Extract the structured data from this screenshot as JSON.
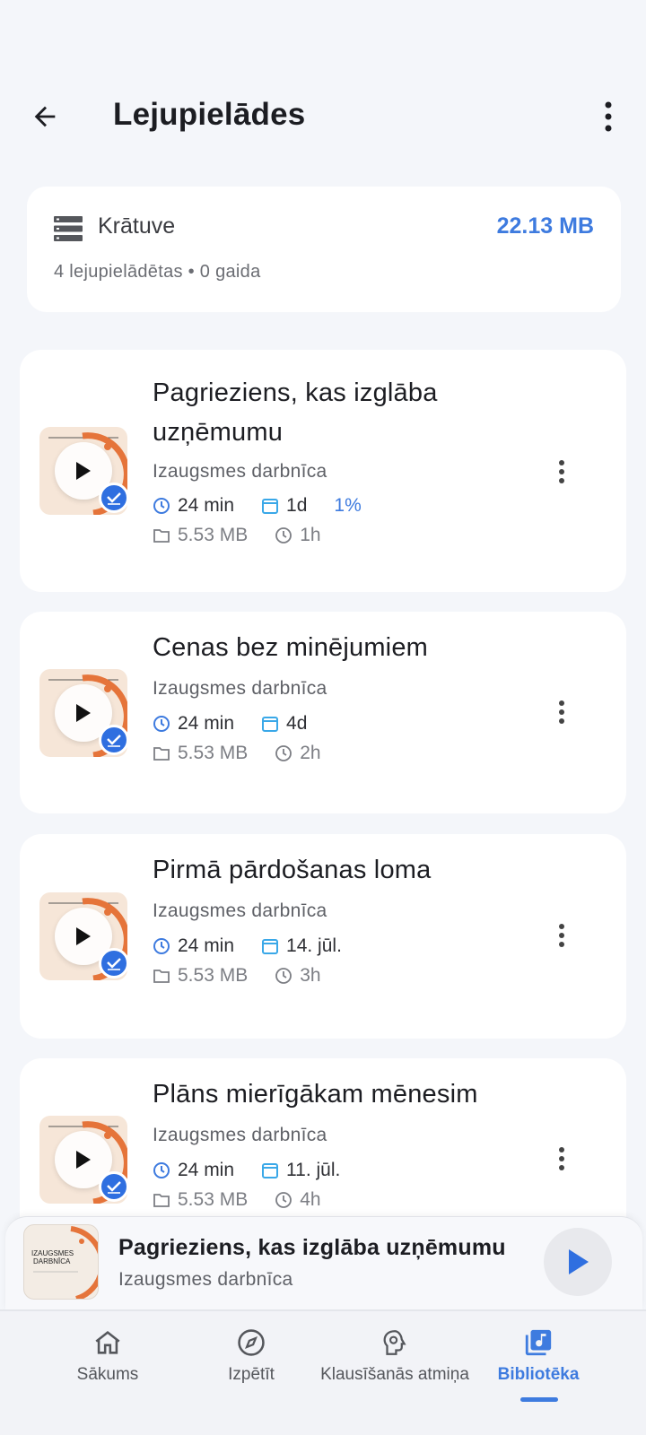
{
  "header": {
    "title": "Lejupielādes",
    "back_icon": "arrow-left-icon",
    "more_icon": "more-vertical-icon"
  },
  "storage": {
    "label": "Krātuve",
    "size": "22.13 MB",
    "summary": "4 lejupielādētas • 0 gaida"
  },
  "episodes": [
    {
      "title": "Pagrieziens, kas izglāba uzņēmumu",
      "author": "Izaugsmes darbnīca",
      "duration": "24 min",
      "date": "1d",
      "progress": "1%",
      "file_size": "5.53 MB",
      "time_ago": "1h"
    },
    {
      "title": "Cenas bez minējumiem",
      "author": "Izaugsmes darbnīca",
      "duration": "24 min",
      "date": "4d",
      "file_size": "5.53 MB",
      "time_ago": "2h"
    },
    {
      "title": "Pirmā pārdošanas loma",
      "author": "Izaugsmes darbnīca",
      "duration": "24 min",
      "date": "14. jūl.",
      "file_size": "5.53 MB",
      "time_ago": "3h"
    },
    {
      "title": "Plāns mierīgākam mēnesim",
      "author": "Izaugsmes darbnīca",
      "duration": "24 min",
      "date": "11. jūl.",
      "file_size": "5.53 MB",
      "time_ago": "4h"
    }
  ],
  "mini_player": {
    "title": "Pagrieziens, kas izglāba uzņēmumu",
    "author": "Izaugsmes darbnīca",
    "cover_text_1": "IZAUGSMES",
    "cover_text_2": "DARBNĪCA"
  },
  "nav": {
    "items": [
      {
        "label": "Sākums",
        "icon": "home-icon"
      },
      {
        "label": "Izpētīt",
        "icon": "compass-icon"
      },
      {
        "label": "Klausīšanās atmiņa",
        "icon": "brain-gear-icon"
      },
      {
        "label": "Bibliotēka",
        "icon": "library-music-icon"
      }
    ],
    "active_index": 3
  },
  "colors": {
    "accent": "#3e7bdf",
    "background": "#f4f6fa",
    "card": "#ffffff"
  }
}
